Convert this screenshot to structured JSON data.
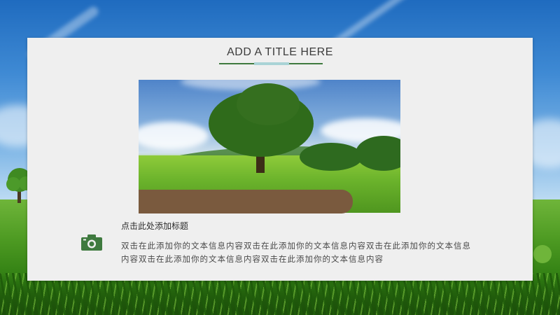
{
  "slide": {
    "title": "ADD A TITLE HERE",
    "subheading": "点击此处添加标题",
    "body": "双击在此添加你的文本信息内容双击在此添加你的文本信息内容双击在此添加你的文本信息内容双击在此添加你的文本信息内容双击在此添加你的文本信息内容"
  },
  "colors": {
    "panel": "#efefef",
    "accent_green": "#3f7a3f",
    "accent_teal": "#a9d3d6",
    "bar_brown": "#7a5a3e",
    "icon_green": "#3f7a3f"
  },
  "icons": {
    "camera": "camera-icon"
  }
}
